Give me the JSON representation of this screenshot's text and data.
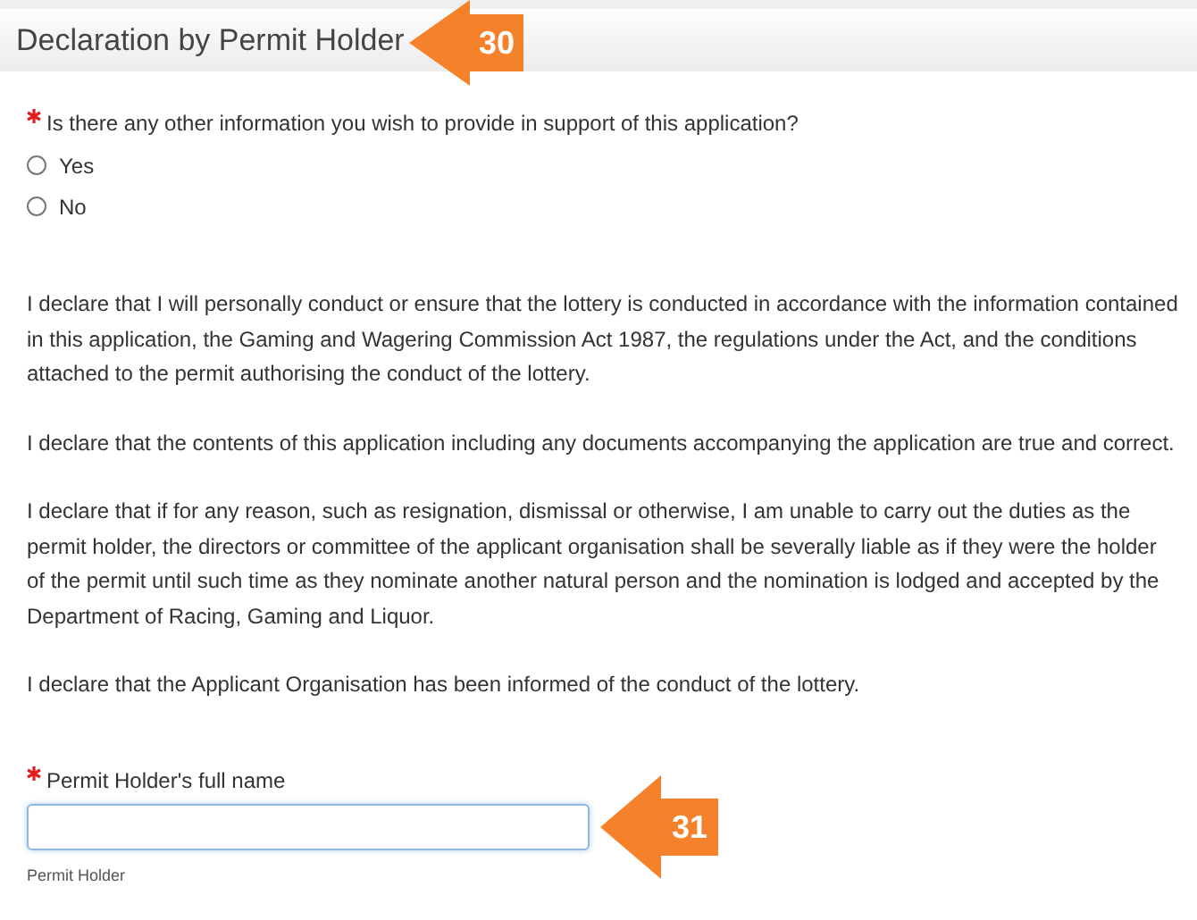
{
  "section": {
    "title": "Declaration by Permit Holder",
    "callout": "30"
  },
  "question": {
    "label": "Is there any other information you wish to provide in support of this application?",
    "required": true,
    "options": [
      {
        "label": "Yes",
        "selected": false
      },
      {
        "label": "No",
        "selected": false
      }
    ]
  },
  "paragraphs": [
    "I declare that I will personally conduct or ensure that the lottery is conducted in accordance with the information contained in this application, the Gaming and Wagering Commission Act 1987, the regulations under the Act, and the conditions attached to the permit authorising the conduct of the lottery.",
    "I declare that the contents of this application including any documents accompanying the application are true and correct.",
    "I declare that if for any reason, such as resignation, dismissal or otherwise, I am unable to carry out the duties as the permit holder, the directors or committee of the applicant organisation shall be severally liable as if they were the holder of the permit until such time as they nominate another natural person and the nomination is lodged and accepted by the Department of Racing, Gaming and Liquor.",
    "I declare that the Applicant Organisation has been informed of the conduct of the lottery."
  ],
  "name_field": {
    "label": "Permit Holder's full name",
    "required": true,
    "helper": "Permit Holder",
    "callout": "31"
  }
}
